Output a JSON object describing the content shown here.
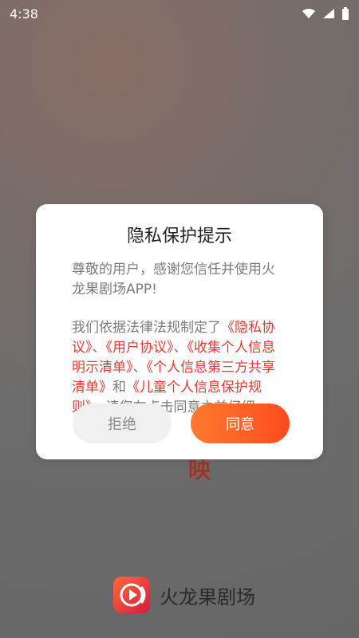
{
  "status_bar": {
    "time": "4:38",
    "icons": [
      "wifi-icon",
      "signal-icon",
      "battery-icon"
    ]
  },
  "background": {
    "partial_text": "映",
    "brand_name": "火龙果剧场"
  },
  "dialog": {
    "title": "隐私保护提示",
    "greeting": "尊敬的用户，感谢您信任并使用火龙果剧场APP!",
    "paragraph_prefix": "我们依据法律法规制定了",
    "links": [
      "《隐私协议》",
      "《用户协议》",
      "《收集个人信息明示清单》",
      "《个人信息第三方共享清单》",
      "《儿童个人信息保护规则》"
    ],
    "separators": [
      "、",
      "、",
      "、",
      "和"
    ],
    "paragraph_suffix": "，请您在点击同意之前仔细",
    "buttons": {
      "refuse": "拒绝",
      "agree": "同意"
    }
  },
  "colors": {
    "link": "#e53935",
    "agree_start": "#ff7a2f",
    "agree_end": "#ff4b1f"
  }
}
